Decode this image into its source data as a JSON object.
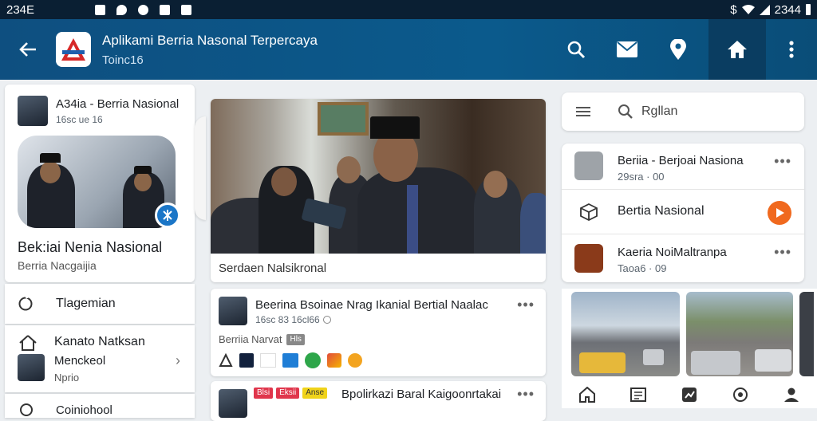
{
  "status_bar": {
    "time_left": "234E",
    "time_right": "2344"
  },
  "header": {
    "title": "Aplikami Berria Nasonal Terpercaya",
    "subtitle": "Toinc16"
  },
  "left_card": {
    "author": "A34ia - Berria Nasional",
    "meta": "16sc ue 16",
    "headline": "Bek:iai Nenia Nasional",
    "subline": "Berria Nacgaijia"
  },
  "left_menu": {
    "item1": "Tlagemian",
    "item2_line1": "Kanato Natksan",
    "item2_line2": "Menckeol",
    "item2_line3": "Nprio",
    "item3": "Coiniohool"
  },
  "main_image": {
    "caption": "Serdaen Nalsikronal"
  },
  "post": {
    "title": "Beerina Bsoinae Nrag Ikanial Bertial Naalac",
    "meta": "16sc 83 16cl66",
    "source": "Berriia Narvat",
    "badge": "Hls"
  },
  "post2": {
    "title": "Bpolirkazi Baral Kaigoonrtakai",
    "tag1": "Blsi",
    "tag2": "Eksii",
    "tag3": "Anse"
  },
  "search": {
    "placeholder": "Rgllan"
  },
  "right_list": [
    {
      "title": "Beriia - Berjoai Nasiona",
      "meta": "29sra · 00"
    },
    {
      "title": "Bertia Nasional",
      "meta": ""
    },
    {
      "title": "Kaeria NoiMaltranpa",
      "meta": "Taoa6 · 09"
    }
  ],
  "colors": {
    "appbar": "#0b5a8c",
    "accent_orange": "#f0691e",
    "accent_green": "#2e8b57",
    "statusbar": "#0a1f33"
  }
}
